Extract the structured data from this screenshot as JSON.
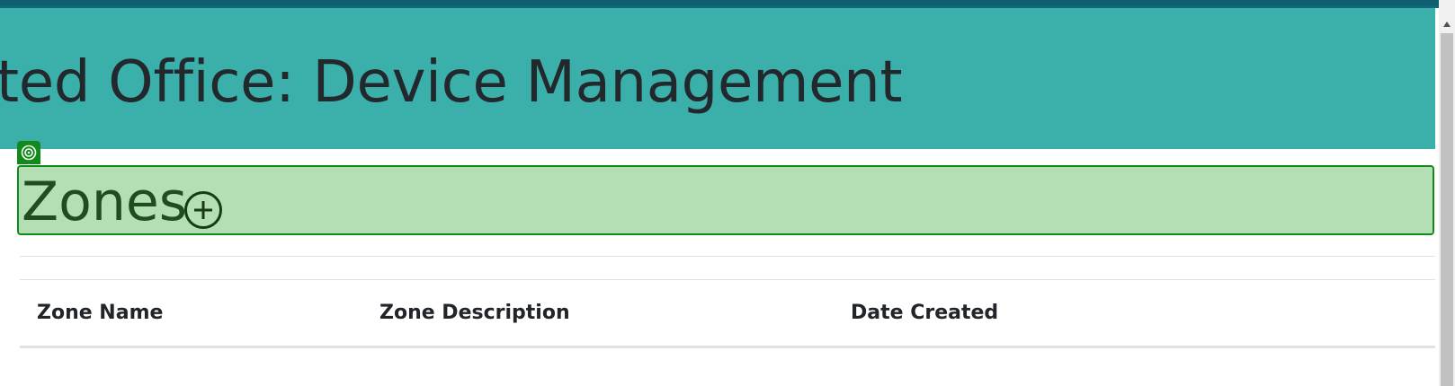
{
  "header": {
    "title": "ted Office: Device Management"
  },
  "zones": {
    "title": "Zones",
    "add_button_icon": "plus-circle-icon"
  },
  "inspector": {
    "icon": "target-icon",
    "highlight_color": "#118a1a"
  },
  "table": {
    "columns": [
      "Zone Name",
      "Zone Description",
      "Date Created"
    ]
  },
  "colors": {
    "banner": "#3bafaa",
    "topbar": "#0f5f70",
    "highlight_fill": "#b4dfb5"
  }
}
